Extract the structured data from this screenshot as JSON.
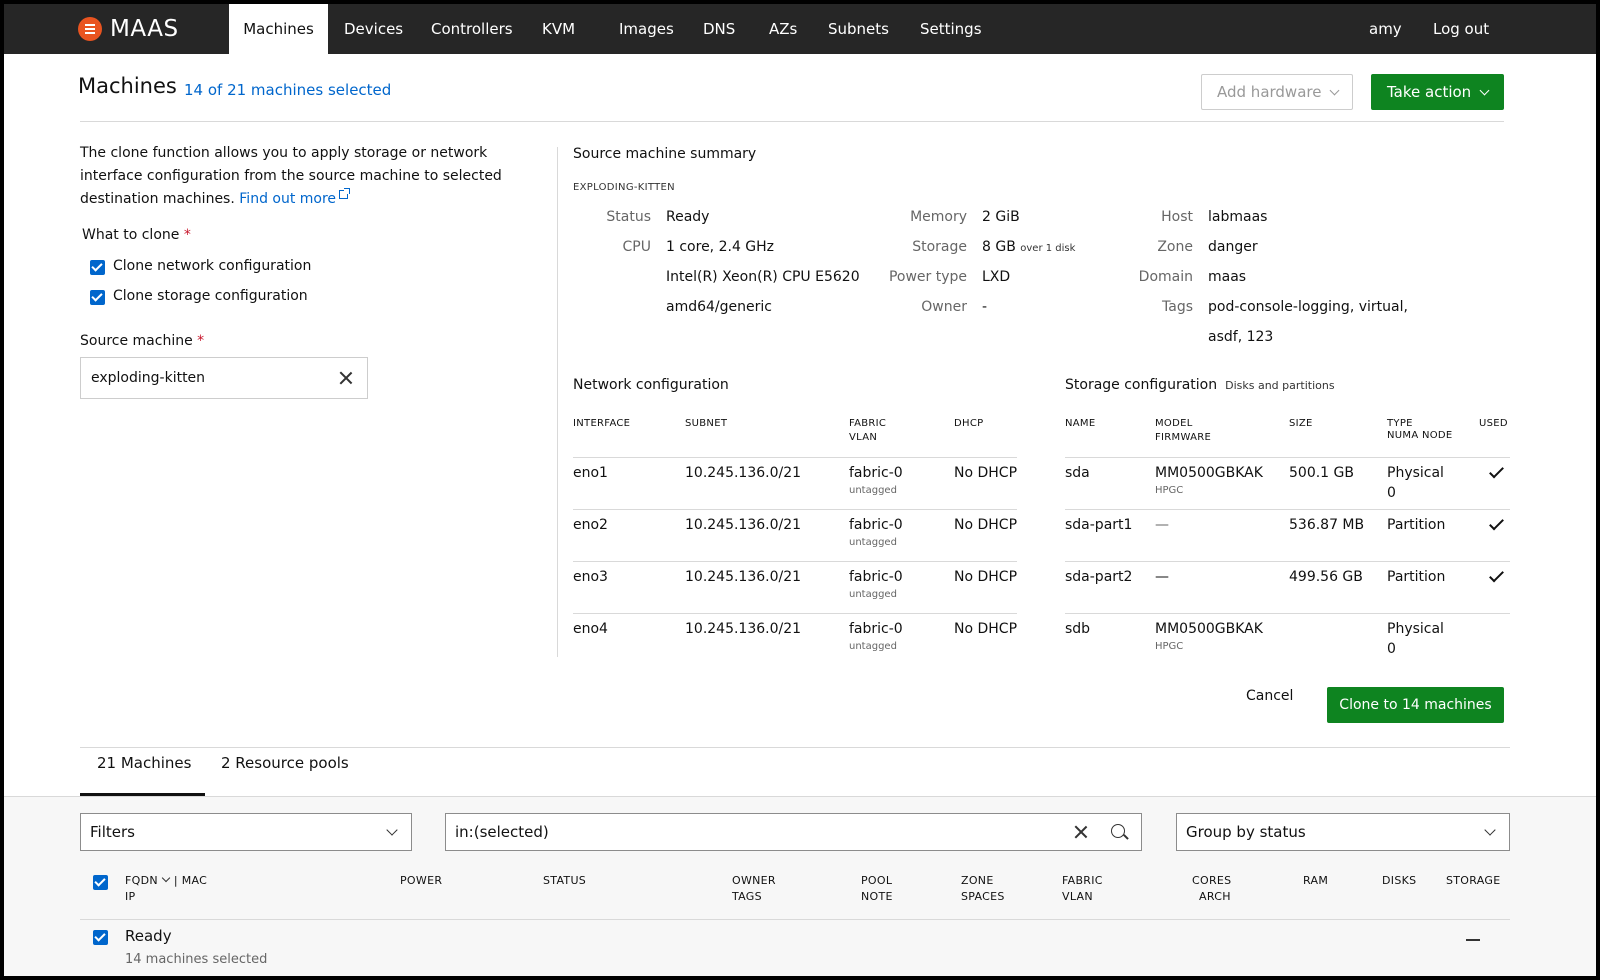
{
  "nav": {
    "brand": "MAAS",
    "items": [
      "Machines",
      "Devices",
      "Controllers",
      "KVM",
      "Images",
      "DNS",
      "AZs",
      "Subnets",
      "Settings"
    ],
    "active_index": 0,
    "user": "amy",
    "logout": "Log out"
  },
  "header": {
    "title": "Machines",
    "selected": "14 of 21 machines selected",
    "add_hardware": "Add hardware",
    "take_action": "Take action"
  },
  "clone": {
    "intro": "The clone function allows you to apply storage or network interface configuration from the source machine to selected destination machines.",
    "find_out_more": "Find out more",
    "what_to_clone": "What to clone",
    "options": [
      {
        "label": "Clone network configuration",
        "checked": true
      },
      {
        "label": "Clone storage configuration",
        "checked": true
      }
    ],
    "source_label": "Source machine",
    "source_value": "exploding-kitten",
    "required_mark": "*"
  },
  "summary": {
    "title": "Source machine summary",
    "hostname": "EXPLODING-KITTEN",
    "status_k": "Status",
    "status_v": "Ready",
    "cpu_k": "CPU",
    "cpu_v1": "1 core, 2.4 GHz",
    "cpu_v2": "Intel(R) Xeon(R) CPU E5620",
    "cpu_v3": "amd64/generic",
    "memory_k": "Memory",
    "memory_v": "2 GiB",
    "storage_k": "Storage",
    "storage_v": "8 GB",
    "storage_note": "over 1 disk",
    "power_k": "Power type",
    "power_v": "LXD",
    "owner_k": "Owner",
    "owner_v": "-",
    "host_k": "Host",
    "host_v": "labmaas",
    "zone_k": "Zone",
    "zone_v": "danger",
    "domain_k": "Domain",
    "domain_v": "maas",
    "tags_k": "Tags",
    "tags_v1": "pod-console-logging, virtual,",
    "tags_v2": "asdf, 123"
  },
  "network": {
    "title": "Network configuration",
    "headers": [
      "INTERFACE",
      "SUBNET",
      "FABRIC",
      "VLAN",
      "DHCP"
    ],
    "rows": [
      {
        "interface": "eno1",
        "subnet": "10.245.136.0/21",
        "fabric": "fabric-0",
        "vlan": "untagged",
        "dhcp": "No DHCP"
      },
      {
        "interface": "eno2",
        "subnet": "10.245.136.0/21",
        "fabric": "fabric-0",
        "vlan": "untagged",
        "dhcp": "No DHCP"
      },
      {
        "interface": "eno3",
        "subnet": "10.245.136.0/21",
        "fabric": "fabric-0",
        "vlan": "untagged",
        "dhcp": "No DHCP"
      },
      {
        "interface": "eno4",
        "subnet": "10.245.136.0/21",
        "fabric": "fabric-0",
        "vlan": "untagged",
        "dhcp": "No DHCP"
      }
    ]
  },
  "storage": {
    "title": "Storage configuration",
    "subtitle": "Disks and partitions",
    "headers": [
      "NAME",
      "MODEL",
      "FIRMWARE",
      "SIZE",
      "TYPE",
      "NUMA NODE",
      "USED"
    ],
    "rows": [
      {
        "name": "sda",
        "model": "MM0500GBKAK",
        "firmware": "HPGC",
        "size": "500.1 GB",
        "type": "Physical",
        "numa": "0",
        "used": true
      },
      {
        "name": "sda-part1",
        "model": "—",
        "firmware": "",
        "size": "536.87 MB",
        "type": "Partition",
        "numa": "",
        "used": true
      },
      {
        "name": "sda-part2",
        "model": "—",
        "firmware": "",
        "size": "499.56 GB",
        "type": "Partition",
        "numa": "",
        "used": true
      },
      {
        "name": "sdb",
        "model": "MM0500GBKAK",
        "firmware": "HPGC",
        "size": "",
        "type": "Physical",
        "numa": "0",
        "used": false
      }
    ]
  },
  "actions": {
    "cancel": "Cancel",
    "clone": "Clone to 14 machines"
  },
  "tabs": [
    "21 Machines",
    "2 Resource pools"
  ],
  "filters": {
    "filters_label": "Filters",
    "search_value": "in:(selected)",
    "group_by": "Group by status"
  },
  "list": {
    "headers": {
      "fqdn": "FQDN",
      "mac": "| MAC",
      "ip": "IP",
      "power": "POWER",
      "status": "STATUS",
      "owner": "OWNER",
      "tags": "TAGS",
      "pool": "POOL",
      "note": "NOTE",
      "zone": "ZONE",
      "spaces": "SPACES",
      "fabric": "FABRIC",
      "vlan": "VLAN",
      "cores": "CORES",
      "arch": "ARCH",
      "ram": "RAM",
      "disks": "DISKS",
      "storage": "STORAGE"
    },
    "group": {
      "name": "Ready",
      "count": "14 machines selected"
    }
  },
  "colors": {
    "accent_green": "#0e8420",
    "link_blue": "#0066cc",
    "brand_orange": "#e95420",
    "nav_bg": "#262626"
  }
}
